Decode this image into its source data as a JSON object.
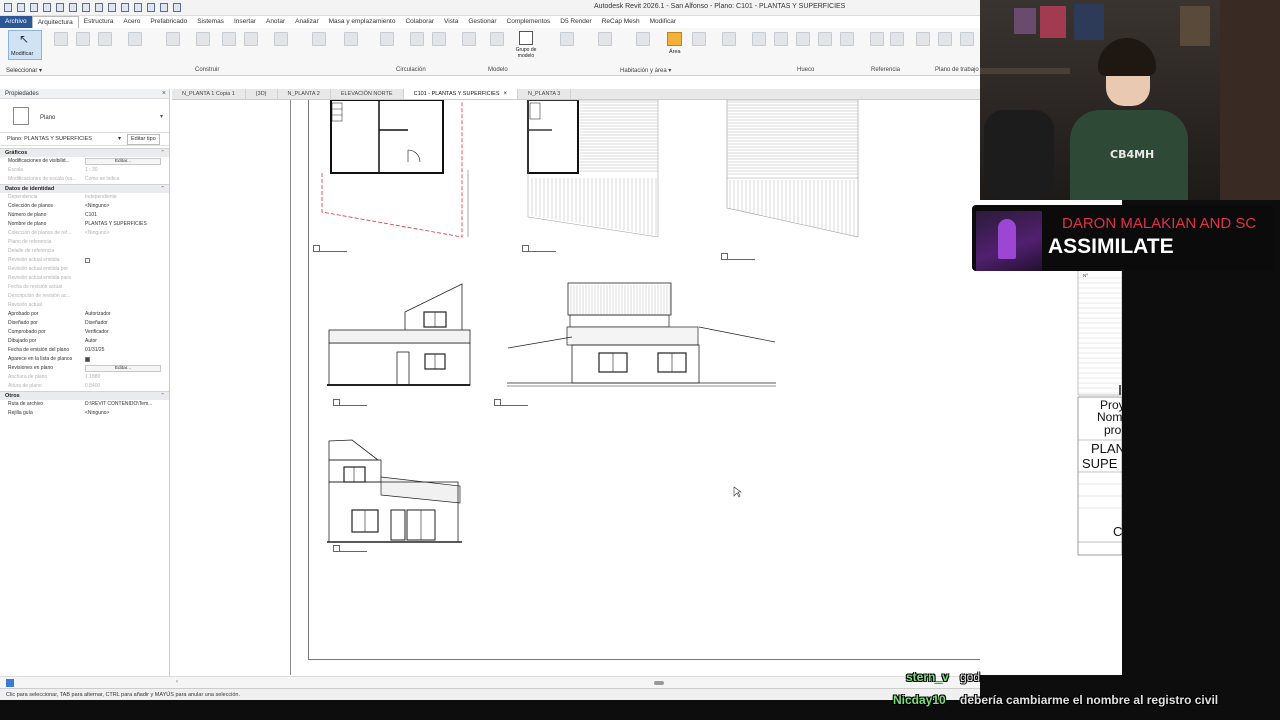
{
  "window": {
    "title": "Autodesk Revit 2026.1 - San Alfonso - Plano: C101 - PLANTAS Y SUPERFICIES"
  },
  "menu": {
    "items": [
      "Archivo",
      "Arquitectura",
      "Estructura",
      "Acero",
      "Prefabricado",
      "Sistemas",
      "Insertar",
      "Anotar",
      "Analizar",
      "Masa y emplazamiento",
      "Colaborar",
      "Vista",
      "Gestionar",
      "Complementos",
      "D5 Render",
      "ReCap Mesh",
      "Modificar"
    ]
  },
  "ribbon": {
    "modificar_label": "Modificar",
    "seleccionar_label": "Seleccionar",
    "grupo_label": "Grupo de modelo",
    "area_label": "Área",
    "panels": [
      "Construir",
      "Circulación",
      "Modelo",
      "Habitación y área",
      "Hueco",
      "Referencia",
      "Plano de trabajo"
    ]
  },
  "properties": {
    "header": "Propiedades",
    "type_name": "Plano",
    "selector_label": "Plano: PLANTAS Y SUPERFICIES",
    "edit_type": "Editar tipo",
    "groups": [
      {
        "name": "Gráficos",
        "rows": [
          {
            "k": "Modificaciones de visibilid...",
            "v": "",
            "edit": "Editar..."
          },
          {
            "k": "Escala",
            "v": "1 : 30",
            "dim": true
          },
          {
            "k": "Modificaciones de escala (va...",
            "v": "Como se indica",
            "dim": true
          }
        ]
      },
      {
        "name": "Datos de identidad",
        "rows": [
          {
            "k": "Dependencia",
            "v": "Independiente",
            "dim": true
          },
          {
            "k": "Colección de planos",
            "v": "<Ninguno>"
          },
          {
            "k": "Número de plano",
            "v": "C101"
          },
          {
            "k": "Nombre de plano",
            "v": "PLANTAS Y SUPERFICIES"
          },
          {
            "k": "Colección de planos de ref...",
            "v": "<Ninguno>",
            "dim": true
          },
          {
            "k": "Plano de referencia",
            "v": "",
            "dim": true
          },
          {
            "k": "Detalle de referencia",
            "v": "",
            "dim": true
          },
          {
            "k": "Revisión actual emitida",
            "v": "",
            "dim": true,
            "check": "off"
          },
          {
            "k": "Revisión actual emitida por",
            "v": "",
            "dim": true
          },
          {
            "k": "Revisión actual emitida para",
            "v": "",
            "dim": true
          },
          {
            "k": "Fecha de revisión actual",
            "v": "",
            "dim": true
          },
          {
            "k": "Descripción de revisión ac...",
            "v": "",
            "dim": true
          },
          {
            "k": "Revisión actual",
            "v": "",
            "dim": true
          },
          {
            "k": "Aprobado por",
            "v": "Autorizador"
          },
          {
            "k": "Diseñado por",
            "v": "Diseñador"
          },
          {
            "k": "Comprobado por",
            "v": "Verificador"
          },
          {
            "k": "Dibujado por",
            "v": "Autor"
          },
          {
            "k": "Fecha de emisión del plano",
            "v": "01/31/25"
          },
          {
            "k": "Aparece en la lista de planos",
            "v": "",
            "check": "on"
          },
          {
            "k": "Revisiones en plano",
            "v": "",
            "edit": "Editar..."
          },
          {
            "k": "Anchura de plano",
            "v": "1.1880",
            "dim": true
          },
          {
            "k": "Altura de plano",
            "v": "0.8400",
            "dim": true
          }
        ]
      },
      {
        "name": "Otros",
        "rows": [
          {
            "k": "Ruta de archivo",
            "v": "D:\\REVIT CONTENIDO\\Tem..."
          },
          {
            "k": "Rejilla guía",
            "v": "<Ninguno>"
          }
        ]
      }
    ]
  },
  "tabs": [
    {
      "label": "N_PLANTA 1 Copia 1"
    },
    {
      "label": "{3D}"
    },
    {
      "label": "N_PLANTA 2"
    },
    {
      "label": "ELEVACIÓN NORTE"
    },
    {
      "label": "C101 - PLANTAS Y SUPERFICIES",
      "active": true
    },
    {
      "label": "N_PLANTA 3"
    }
  ],
  "titleblock": {
    "number_col": "Nº",
    "project_label": "Proy",
    "name_label": "Nom",
    "prop_label": "pro",
    "sheet_title_1": "PLAN",
    "sheet_title_2": "SUPE",
    "sheet_code_partial": "C"
  },
  "status": {
    "text": "Clic para seleccionar, TAB para alternar, CTRL para añadir y MAYÚS para anular una selección."
  },
  "music": {
    "artist": "DARON MALAKIAN AND SC",
    "song": "ASSIMILATE"
  },
  "webcam": {
    "shirt_text": "CB4MH"
  },
  "chat": {
    "messages": [
      {
        "user": "stern_v",
        "text": "god"
      },
      {
        "user": "Nicday10",
        "text": "debería cambiarme el nombre al registro civil"
      }
    ]
  }
}
